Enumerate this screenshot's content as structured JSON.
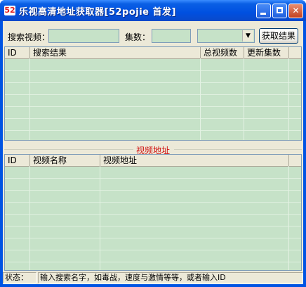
{
  "window": {
    "app_icon": "52-icon",
    "title": "乐视高清地址获取器[52pojie 首发]",
    "minimize_icon": "minimize-icon",
    "maximize_icon": "maximize-icon",
    "close_icon": "close-icon",
    "close_glyph": "✕"
  },
  "search": {
    "video_label": "搜索视频：",
    "video_value": "",
    "episodes_label": "集数：",
    "episodes_value": "",
    "combo_value": "",
    "combo_arrow": "▼",
    "fetch_button": "获取结果"
  },
  "results": {
    "columns": [
      "ID",
      "搜索结果",
      "总视频数",
      "更新集数"
    ],
    "rows": []
  },
  "video_url_group": {
    "title": "视频地址",
    "columns": [
      "ID",
      "视频名称",
      "视频地址"
    ],
    "rows": []
  },
  "status": {
    "label": "状态：",
    "text": "输入搜索名字，如毒战，速度与激情等等，或者输入ID"
  },
  "colors": {
    "list_background": "#c6e2c8",
    "titlebar": "#0054e3",
    "group_title": "#d01010"
  }
}
